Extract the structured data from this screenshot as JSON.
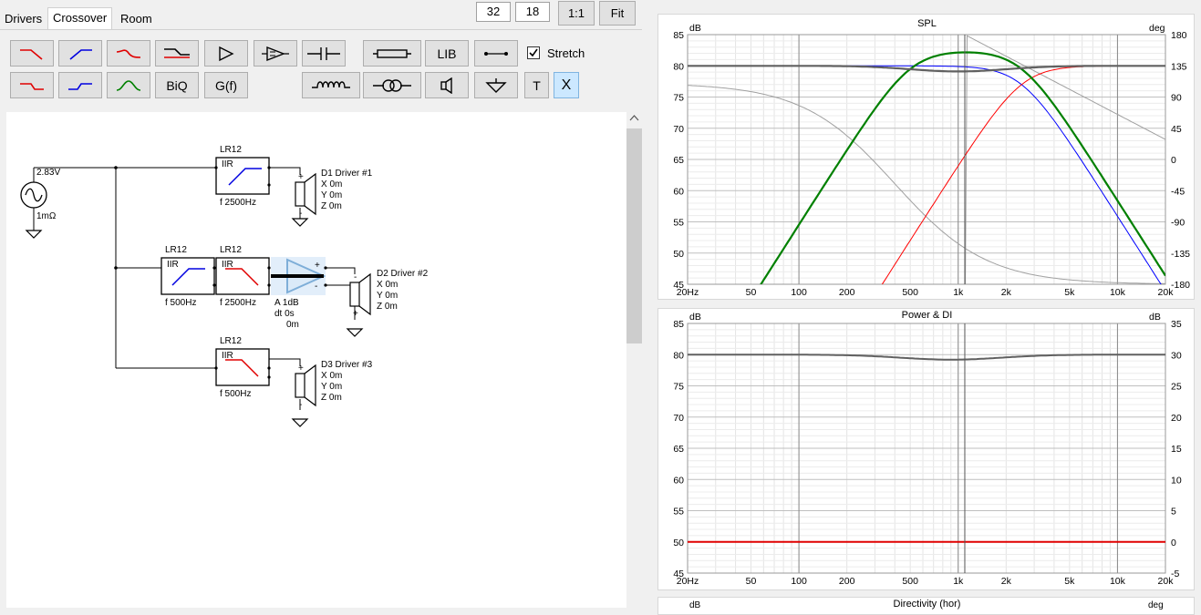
{
  "tabs": [
    "Drivers",
    "Crossover",
    "Room"
  ],
  "view": {
    "field_a": "32",
    "field_b": "18",
    "one_to_one": "1:1",
    "fit": "Fit"
  },
  "toolbar": {
    "lib": "LIB",
    "biq": "BiQ",
    "gf": "G(f)",
    "t": "T",
    "x": "X",
    "stretch_label": "Stretch",
    "stretch_checked": true
  },
  "schematic": {
    "source": {
      "voltage": "2.83V",
      "impedance": "1mΩ"
    },
    "filters": [
      {
        "type_label": "LR12",
        "kind": "IIR",
        "freq": "f   2500Hz"
      },
      {
        "type_label": "LR12",
        "kind": "IIR",
        "freq": "f   500Hz"
      },
      {
        "type_label": "LR12",
        "kind": "IIR",
        "freq": "f   2500Hz"
      },
      {
        "type_label": "LR12",
        "kind": "IIR",
        "freq": "f   500Hz"
      }
    ],
    "amp": {
      "gain": "A   1dB",
      "delay": "dt 0s",
      "dist": "0m"
    },
    "drivers": [
      {
        "name": "D1 Driver #1",
        "x": "X 0m",
        "y": "Y 0m",
        "z": "Z 0m"
      },
      {
        "name": "D2 Driver #2",
        "x": "X 0m",
        "y": "Y 0m",
        "z": "Z 0m"
      },
      {
        "name": "D3 Driver #3",
        "x": "X 0m",
        "y": "Y 0m",
        "z": "Z 0m"
      }
    ]
  },
  "spl_graph": {
    "title": "SPL",
    "left_unit": "dB",
    "right_unit": "deg",
    "left_ticks": [
      "85",
      "80",
      "75",
      "70",
      "65",
      "60",
      "55",
      "50",
      "45"
    ],
    "right_ticks": [
      "180",
      "135",
      "90",
      "45",
      "0",
      "-45",
      "-90",
      "-135",
      "-180"
    ],
    "x_ticks": [
      "20Hz",
      "50",
      "100",
      "200",
      "500",
      "1k",
      "2k",
      "5k",
      "10k",
      "20k"
    ]
  },
  "power_graph": {
    "title": "Power & DI",
    "left_unit": "dB",
    "right_unit": "dB",
    "left_ticks": [
      "85",
      "80",
      "75",
      "70",
      "65",
      "60",
      "55",
      "50",
      "45"
    ],
    "right_ticks": [
      "35",
      "30",
      "25",
      "20",
      "15",
      "10",
      "5",
      "0",
      "-5"
    ],
    "x_ticks": [
      "20Hz",
      "50",
      "100",
      "200",
      "500",
      "1k",
      "2k",
      "5k",
      "10k",
      "20k"
    ]
  },
  "directivity_graph": {
    "title": "Directivity (hor)",
    "left_unit": "dB",
    "right_unit": "deg"
  },
  "colors": {
    "lowpass": "#0000ff",
    "highpass": "#ff0000",
    "bandpass": "#008000",
    "sum": "#606060",
    "selection": "#cce8ff"
  }
}
